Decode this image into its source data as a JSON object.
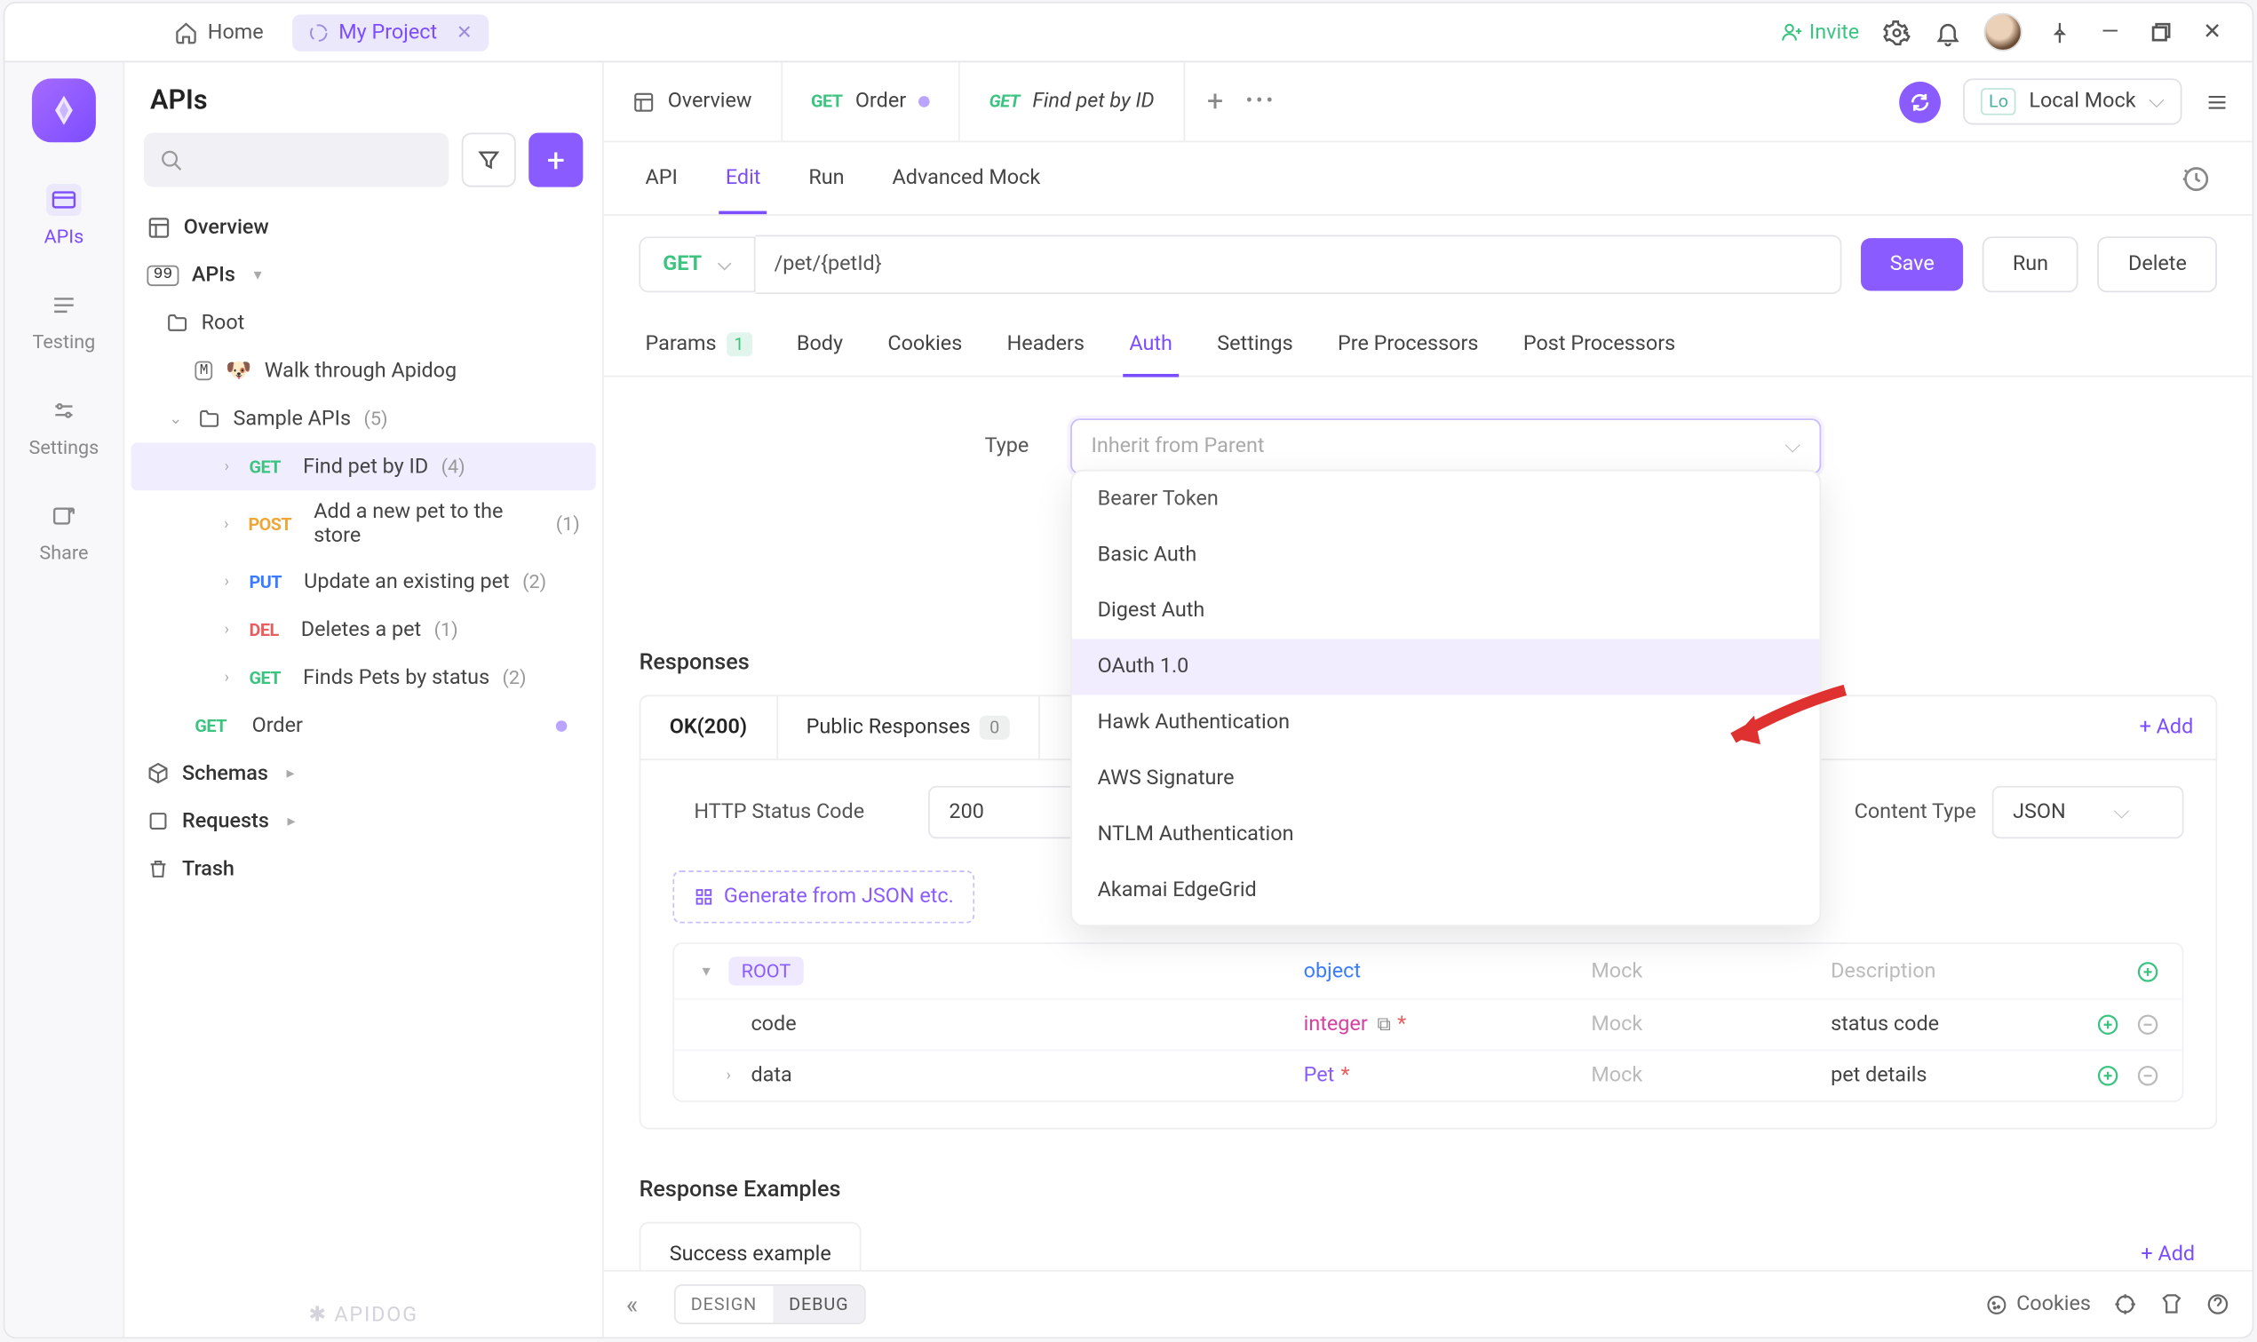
{
  "titlebar": {
    "home": "Home",
    "project": "My Project",
    "invite": "Invite"
  },
  "rail": {
    "items": [
      "APIs",
      "Testing",
      "Settings",
      "Share"
    ]
  },
  "sidebar": {
    "title": "APIs",
    "overview": "Overview",
    "apis_label": "APIs",
    "root": "Root",
    "walkthrough": "Walk through Apidog",
    "sample": "Sample APIs",
    "sample_count": "(5)",
    "endpoints": [
      {
        "method": "GET",
        "label": "Find pet by ID",
        "count": "(4)"
      },
      {
        "method": "POST",
        "label": "Add a new pet to the store",
        "count": "(1)"
      },
      {
        "method": "PUT",
        "label": "Update an existing pet",
        "count": "(2)"
      },
      {
        "method": "DEL",
        "label": "Deletes a pet",
        "count": "(1)"
      },
      {
        "method": "GET",
        "label": "Finds Pets by status",
        "count": "(2)"
      }
    ],
    "order": {
      "method": "GET",
      "label": "Order"
    },
    "schemas": "Schemas",
    "requests": "Requests",
    "trash": "Trash",
    "brand": "APIDOG"
  },
  "tabs": {
    "overview": "Overview",
    "order": {
      "method": "GET",
      "label": "Order"
    },
    "findpet": {
      "method": "GET",
      "label": "Find pet by ID"
    },
    "env_prefix": "Lo",
    "env": "Local Mock"
  },
  "subtabs": [
    "API",
    "Edit",
    "Run",
    "Advanced Mock"
  ],
  "url": {
    "method": "GET",
    "path": "/pet/{petId}",
    "save": "Save",
    "run": "Run",
    "delete": "Delete"
  },
  "reqtabs": {
    "params": "Params",
    "params_count": "1",
    "body": "Body",
    "cookies": "Cookies",
    "headers": "Headers",
    "auth": "Auth",
    "settings": "Settings",
    "pre": "Pre Processors",
    "post": "Post Processors"
  },
  "auth": {
    "type_label": "Type",
    "placeholder": "Inherit from Parent",
    "options": [
      "Bearer Token",
      "Basic Auth",
      "Digest Auth",
      "OAuth 1.0",
      "Hawk Authentication",
      "AWS Signature",
      "NTLM Authentication",
      "Akamai EdgeGrid"
    ]
  },
  "responses": {
    "heading": "Responses",
    "ok": "OK(200)",
    "public": "Public Responses",
    "public_count": "0",
    "add": "+ Add",
    "http_label": "HTTP Status Code",
    "http_val": "200",
    "ct_label": "Content Type",
    "ct_val": "JSON",
    "gen": "Generate from JSON etc.",
    "cols": {
      "mock": "Mock",
      "desc": "Description"
    },
    "rows": [
      {
        "name": "ROOT",
        "type": "object",
        "required": false,
        "desc": ""
      },
      {
        "name": "code",
        "type": "integer",
        "required": true,
        "desc": "status code",
        "combine": true
      },
      {
        "name": "data",
        "type": "Pet",
        "required": true,
        "desc": "pet details"
      }
    ]
  },
  "examples": {
    "heading": "Response Examples",
    "tab": "Success example",
    "add": "+ Add"
  },
  "statusbar": {
    "design": "DESIGN",
    "debug": "DEBUG",
    "cookies": "Cookies"
  }
}
